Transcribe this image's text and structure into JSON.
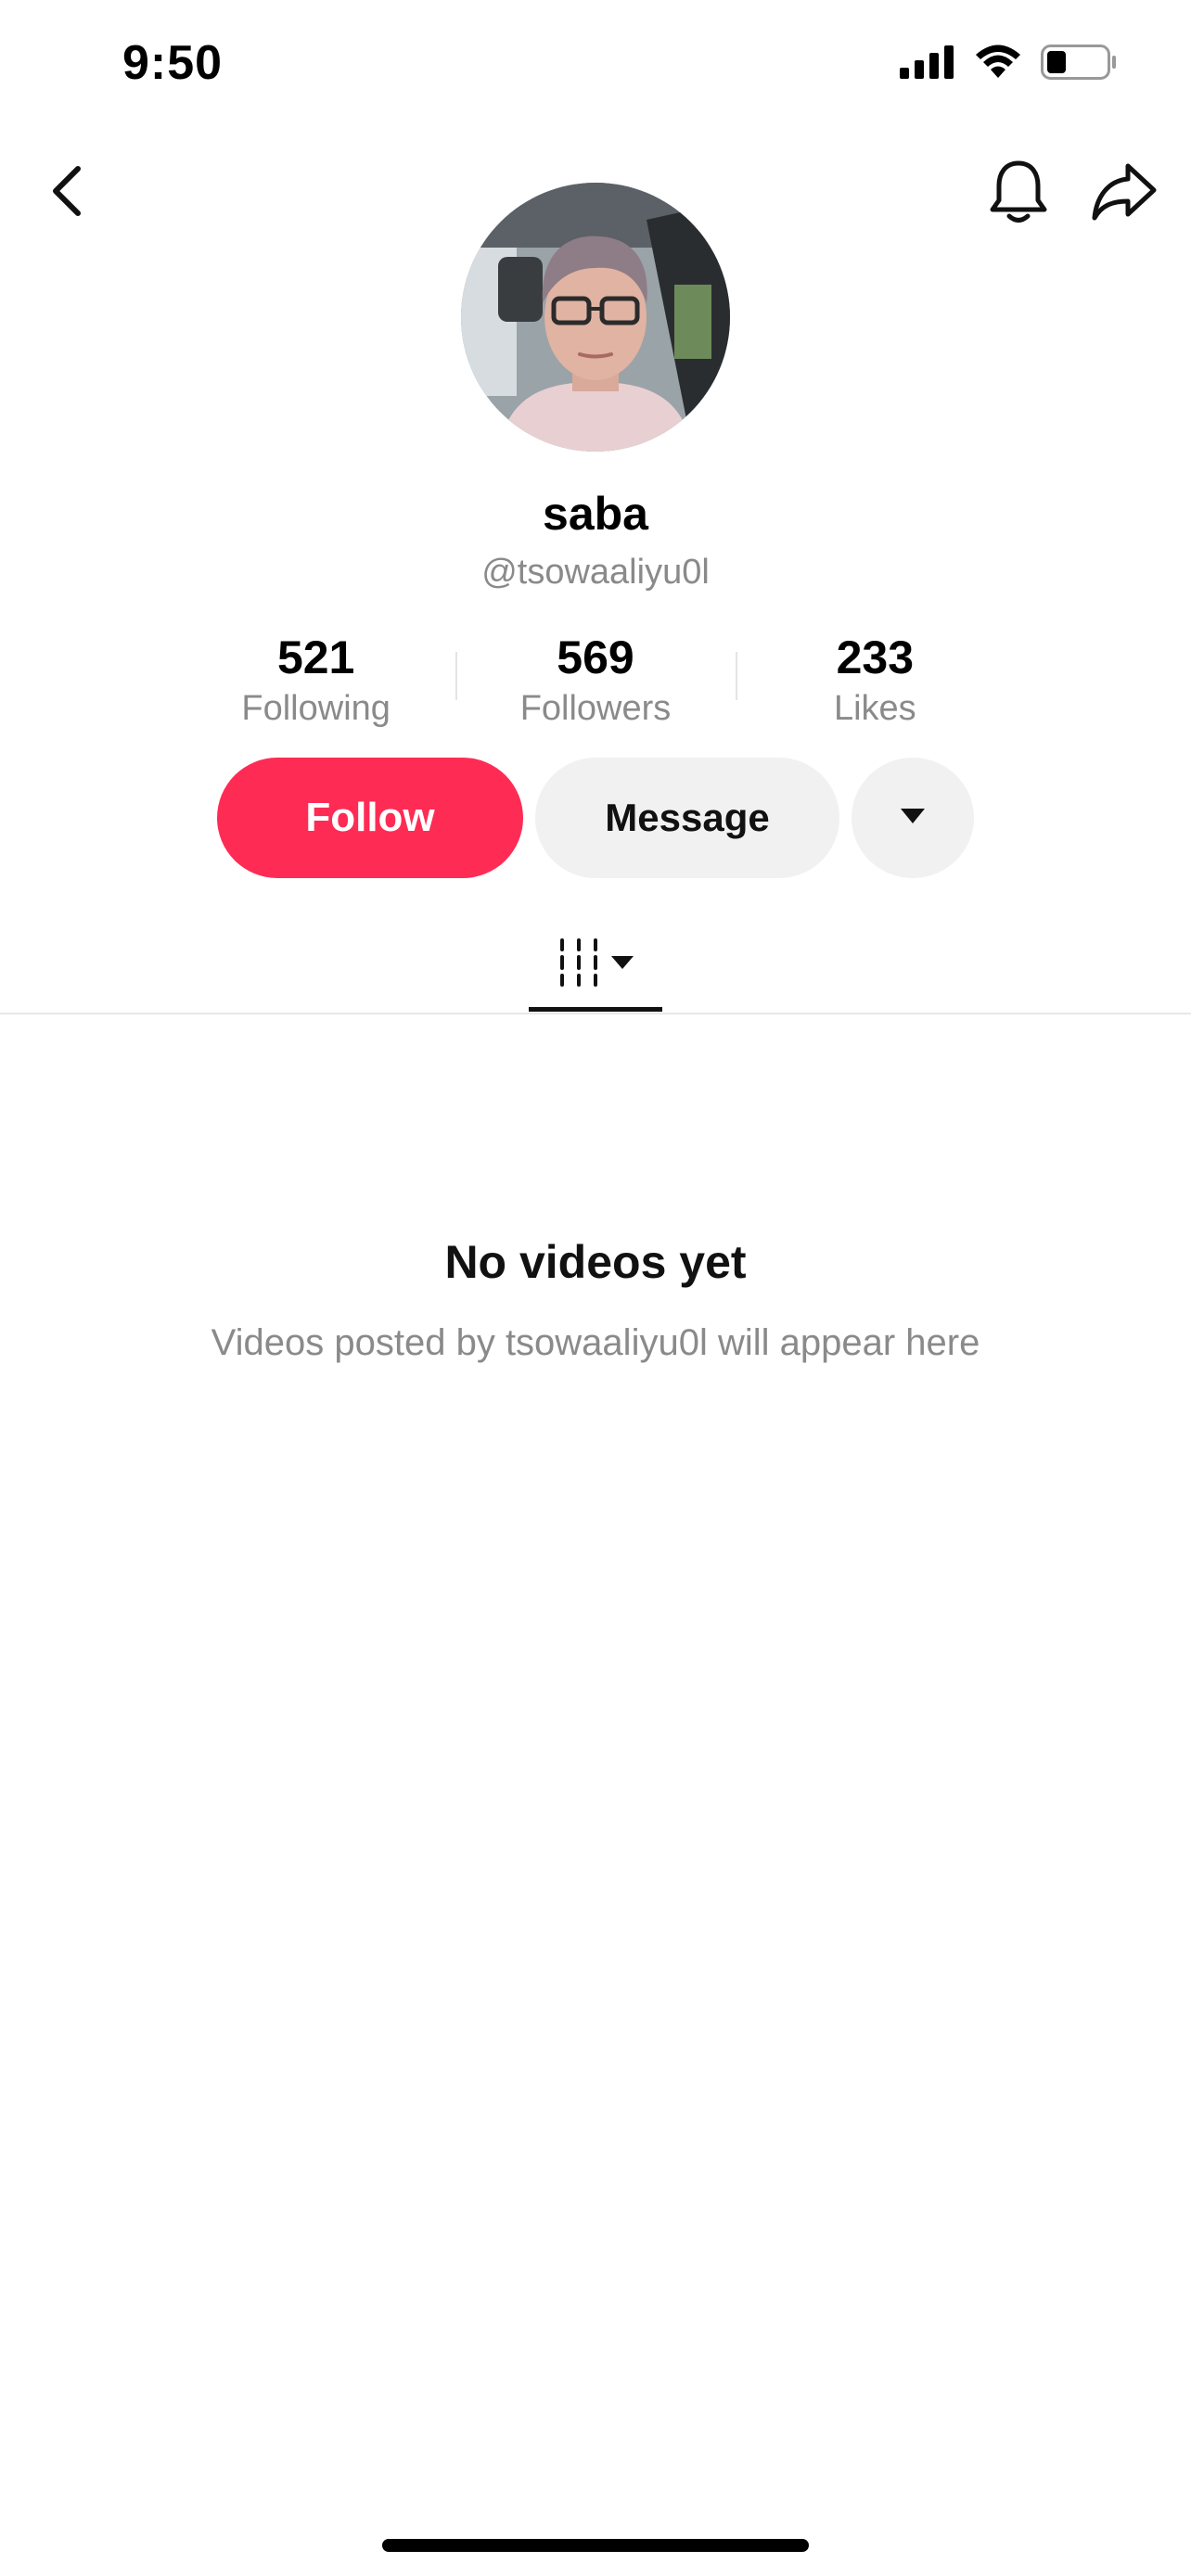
{
  "status_bar": {
    "time": "9:50",
    "signal_icon": "cellular-signal-icon",
    "wifi_icon": "wifi-icon",
    "battery_icon": "battery-icon",
    "battery_level": 0.3
  },
  "nav": {
    "back_icon": "chevron-left-icon",
    "notification_icon": "bell-icon",
    "share_icon": "share-arrow-icon"
  },
  "profile": {
    "display_name": "saba",
    "username": "@tsowaaliyu0l",
    "avatar_icon": "avatar-photo"
  },
  "stats": [
    {
      "value": "521",
      "label": "Following"
    },
    {
      "value": "569",
      "label": "Followers"
    },
    {
      "value": "233",
      "label": "Likes"
    }
  ],
  "actions": {
    "follow_label": "Follow",
    "message_label": "Message",
    "more_icon": "caret-down-icon"
  },
  "tabs": {
    "videos_icon": "video-grid-icon",
    "dropdown_icon": "caret-down-icon"
  },
  "empty_state": {
    "title": "No videos yet",
    "subtitle": "Videos posted by tsowaaliyu0l will appear here"
  },
  "colors": {
    "accent": "#fe2c55",
    "button_bg": "#f1f1f2",
    "secondary_text": "#8a8a8a"
  }
}
